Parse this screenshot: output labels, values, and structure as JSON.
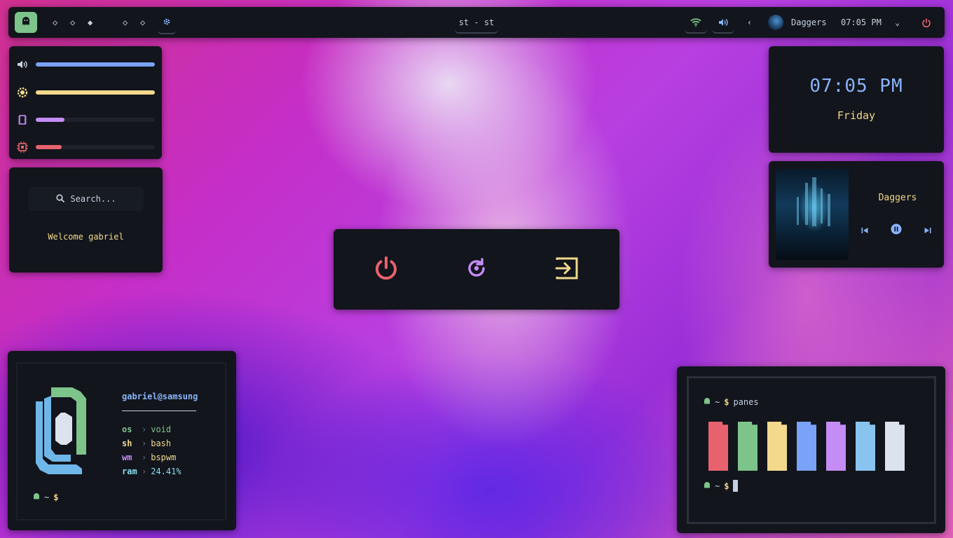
{
  "topbar": {
    "workspaces": [
      "◇",
      "◇",
      "◆",
      "◇",
      "◇"
    ],
    "window_title": "st - st",
    "now_playing": "Daggers",
    "time": "07:05 PM",
    "icons": [
      "ghost-icon",
      "gear-icon",
      "wifi-icon",
      "volume-icon",
      "chevron-left-icon",
      "chevron-down-icon",
      "power-icon"
    ],
    "colors": {
      "accent_green": "#7dc48a",
      "accent_blue": "#89b4fa",
      "accent_red": "#e8626e"
    }
  },
  "sliders": [
    {
      "name": "volume",
      "icon": "volume-icon",
      "value": 1.0,
      "color": "#7aa2f7"
    },
    {
      "name": "brightness",
      "icon": "brightness-icon",
      "value": 1.0,
      "color": "#f2d98c"
    },
    {
      "name": "memory",
      "icon": "memory-icon",
      "value": 0.24,
      "color": "#c58cf5"
    },
    {
      "name": "cpu",
      "icon": "cpu-icon",
      "value": 0.22,
      "color": "#e8626e"
    }
  ],
  "search": {
    "placeholder": "Search...",
    "welcome": "Welcome gabriel"
  },
  "power_menu": {
    "buttons": [
      {
        "name": "shutdown",
        "icon": "power-icon",
        "color": "#e8626e"
      },
      {
        "name": "reboot",
        "icon": "restart-icon",
        "color": "#c58cf5"
      },
      {
        "name": "logout",
        "icon": "logout-icon",
        "color": "#f2d98c"
      }
    ]
  },
  "clock": {
    "time": "07:05 PM",
    "day": "Friday"
  },
  "music": {
    "title": "Daggers",
    "playing": true
  },
  "fetch": {
    "user": "gabriel@samsung",
    "rows": [
      {
        "key": "os",
        "value": "void",
        "color": "#7dc48a"
      },
      {
        "key": "sh",
        "value": "bash",
        "color": "#f2d98c"
      },
      {
        "key": "wm",
        "value": "bspwm",
        "color": "#c58cf5"
      },
      {
        "key": "ram",
        "value": "24.41%",
        "color": "#89dceb"
      }
    ],
    "prompt_path": "~",
    "prompt_symbol": "$"
  },
  "terminal": {
    "prompt_path": "~",
    "prompt_symbol": "$",
    "command": "panes",
    "pane_colors": [
      "#e8626e",
      "#7dc48a",
      "#f2d98c",
      "#7aa2f7",
      "#c58cf5",
      "#89c4f0",
      "#dde3ee"
    ]
  }
}
